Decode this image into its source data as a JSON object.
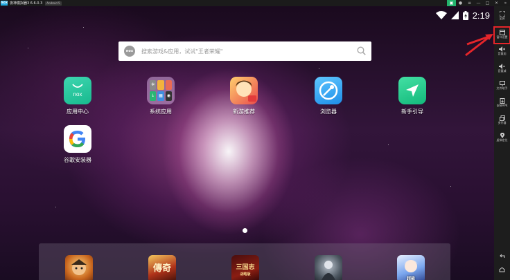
{
  "window": {
    "logo_text": "nox",
    "title": "夜神模拟器3 6.6.0.3",
    "android_badge": "Android 5"
  },
  "status": {
    "time": "2:19"
  },
  "search": {
    "logo_text": "nox",
    "placeholder": "搜索游戏&应用，试试\"王者荣耀\""
  },
  "desktop": {
    "apps": [
      {
        "label": "应用中心",
        "icon_text": "nox"
      },
      {
        "label": "系统应用"
      },
      {
        "label": "新游推荐"
      },
      {
        "label": "浏览器"
      },
      {
        "label": "新手引导"
      },
      {
        "label": "谷歌安装器"
      }
    ]
  },
  "dock": {
    "game3_text": "三国志",
    "game3_sub": "战略版",
    "game2_text": "傳奇",
    "game5_text": "超能"
  },
  "sidebar": {
    "items": [
      {
        "label": "全屏",
        "icon": "fullscreen-icon"
      },
      {
        "label": "窗口设置",
        "icon": "window-icon"
      },
      {
        "label": "音量加",
        "icon": "volume-up-icon"
      },
      {
        "label": "音量减",
        "icon": "volume-down-icon"
      },
      {
        "label": "文件助手",
        "icon": "monitor-icon"
      },
      {
        "label": "安装APK",
        "icon": "apk-icon"
      },
      {
        "label": "多开器",
        "icon": "multi-icon"
      },
      {
        "label": "虚拟定位",
        "icon": "location-icon"
      }
    ]
  },
  "colors": {
    "highlight": "#e5252a",
    "accent_green": "#23b36c",
    "nox_blue": "#21a7e0"
  }
}
